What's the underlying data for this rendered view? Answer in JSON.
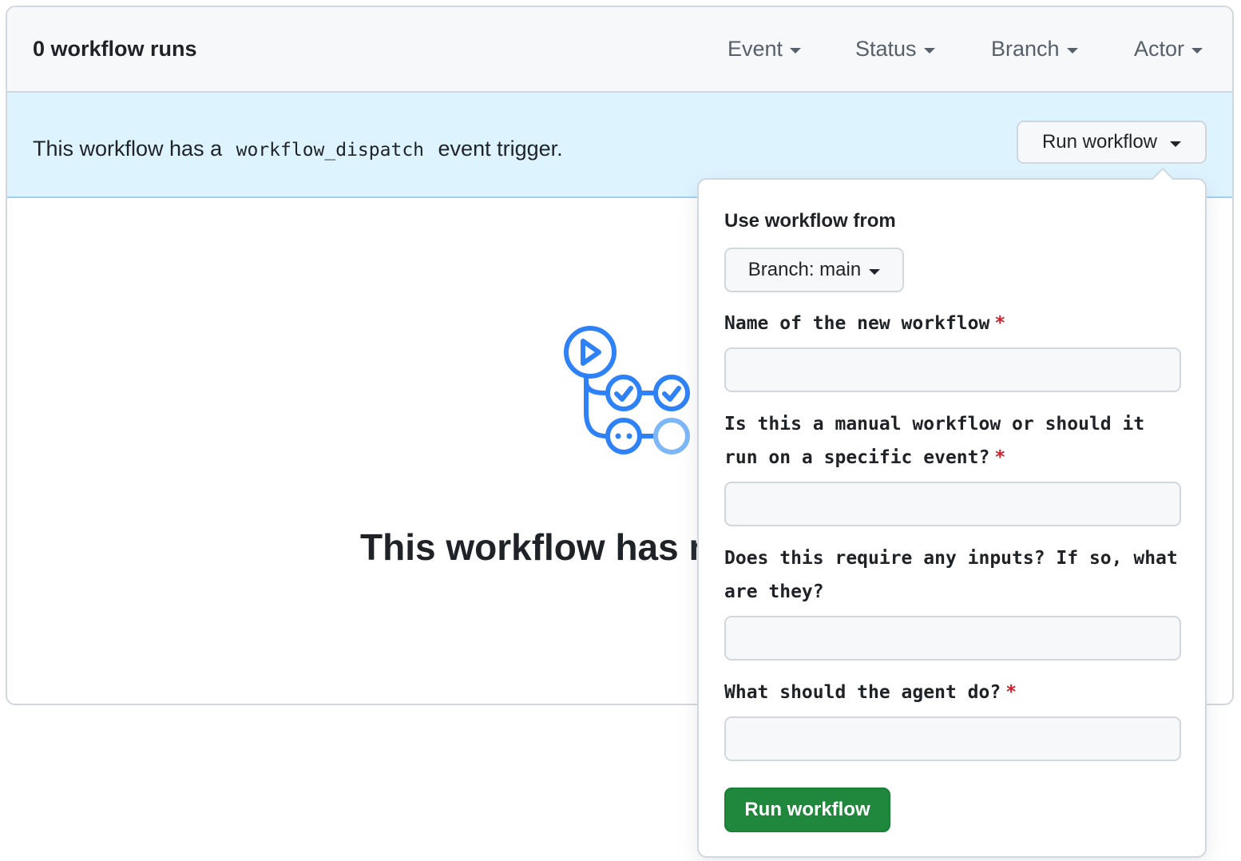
{
  "header": {
    "runs_count": "0 workflow runs",
    "filters": {
      "event": "Event",
      "status": "Status",
      "branch": "Branch",
      "actor": "Actor"
    }
  },
  "banner": {
    "text_before": "This workflow has a",
    "code": "workflow_dispatch",
    "text_after": "event trigger.",
    "run_button": "Run workflow"
  },
  "blankslate": {
    "icon": "actions-workflow-icon",
    "title": "This workflow has no runs yet."
  },
  "popover": {
    "heading": "Use workflow from",
    "branch_button": "Branch: main",
    "fields": [
      {
        "label": "Name of the new workflow",
        "required": "*",
        "value": ""
      },
      {
        "label": "Is this a manual workflow or should it run on a specific event?",
        "required": "*",
        "value": ""
      },
      {
        "label": "Does this require any inputs? If so, what are they?",
        "required": "",
        "value": ""
      },
      {
        "label": "What should the agent do?",
        "required": "*",
        "value": ""
      }
    ],
    "submit_button": "Run workflow"
  },
  "colors": {
    "accent_blue": "#2f81f7",
    "banner_bg": "#ddf4ff",
    "primary_green": "#1f883d",
    "required_red": "#cf222e"
  }
}
